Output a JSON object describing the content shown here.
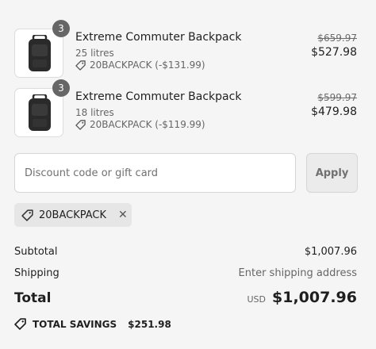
{
  "items": [
    {
      "quantity": "3",
      "name": "Extreme Commuter Backpack",
      "variant": "25 litres",
      "discount": "20BACKPACK (-$131.99)",
      "original_price": "$659.97",
      "price": "$527.98"
    },
    {
      "quantity": "3",
      "name": "Extreme Commuter Backpack",
      "variant": "18 litres",
      "discount": "20BACKPACK (-$119.99)",
      "original_price": "$599.97",
      "price": "$479.98"
    }
  ],
  "discount_input": {
    "placeholder": "Discount code or gift card",
    "value": ""
  },
  "apply_label": "Apply",
  "applied_code": "20BACKPACK",
  "summary": {
    "subtotal_label": "Subtotal",
    "subtotal_value": "$1,007.96",
    "shipping_label": "Shipping",
    "shipping_value": "Enter shipping address",
    "total_label": "Total",
    "currency": "USD",
    "total_value": "$1,007.96"
  },
  "savings": {
    "label": "TOTAL SAVINGS",
    "value": "$251.98"
  },
  "icons": {
    "tag": "tag-icon",
    "remove": "close-icon",
    "savings": "tag-icon"
  },
  "colors": {
    "background": "#f5f5f5",
    "badge": "#666666",
    "chip": "#e6e6e6"
  }
}
